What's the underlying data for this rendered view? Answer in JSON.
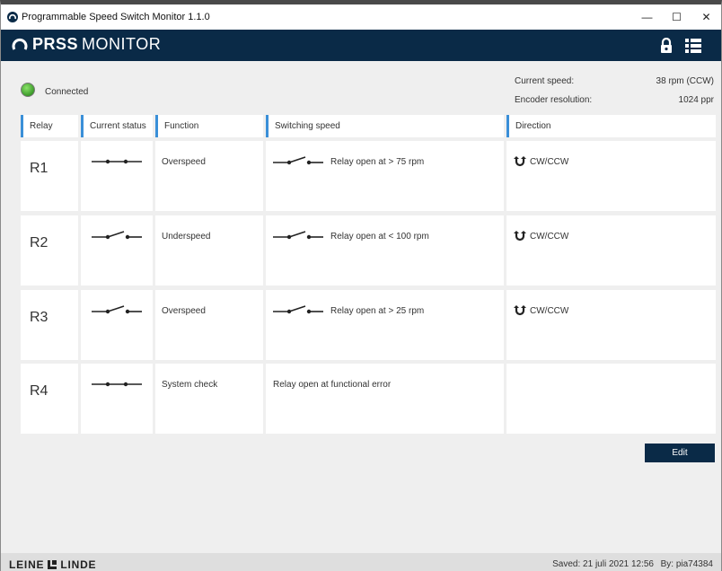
{
  "window": {
    "title": "Programmable Speed Switch Monitor 1.1.0",
    "controls": {
      "minimize": "—",
      "maximize": "☐",
      "close": "✕"
    }
  },
  "appbar": {
    "brand_bold": "PRSS",
    "brand_light": "MONITOR",
    "lock_icon": "lock-icon",
    "menu_icon": "list-menu-icon",
    "color": "#0a2a47"
  },
  "status": {
    "text": "Connected",
    "led_color": "#3c9a2a"
  },
  "info": {
    "current_speed_label": "Current speed:",
    "current_speed_value": "38 rpm (CCW)",
    "encoder_label": "Encoder resolution:",
    "encoder_value": "1024 ppr"
  },
  "table": {
    "headers": {
      "relay": "Relay",
      "status": "Current status",
      "function": "Function",
      "speed": "Switching speed",
      "direction": "Direction"
    },
    "accent_color": "#3a8fd8",
    "rows": [
      {
        "relay": "R1",
        "status": "closed",
        "function": "Overspeed",
        "speed_icon": "open",
        "speed": "Relay open at >  75 rpm",
        "direction": "CW/CCW"
      },
      {
        "relay": "R2",
        "status": "open",
        "function": "Underspeed",
        "speed_icon": "open",
        "speed": "Relay open at <  100 rpm",
        "direction": "CW/CCW"
      },
      {
        "relay": "R3",
        "status": "open",
        "function": "Overspeed",
        "speed_icon": "open",
        "speed": "Relay open at >  25 rpm",
        "direction": "CW/CCW"
      },
      {
        "relay": "R4",
        "status": "closed",
        "function": "System check",
        "speed_icon": "",
        "speed": "Relay open at functional error",
        "direction": ""
      }
    ]
  },
  "edit_button": "Edit",
  "footer": {
    "brand_left": "LEINE",
    "brand_right": "LINDE",
    "saved": "Saved:  21 juli 2021 12:56",
    "by": "By:  pia74384"
  }
}
